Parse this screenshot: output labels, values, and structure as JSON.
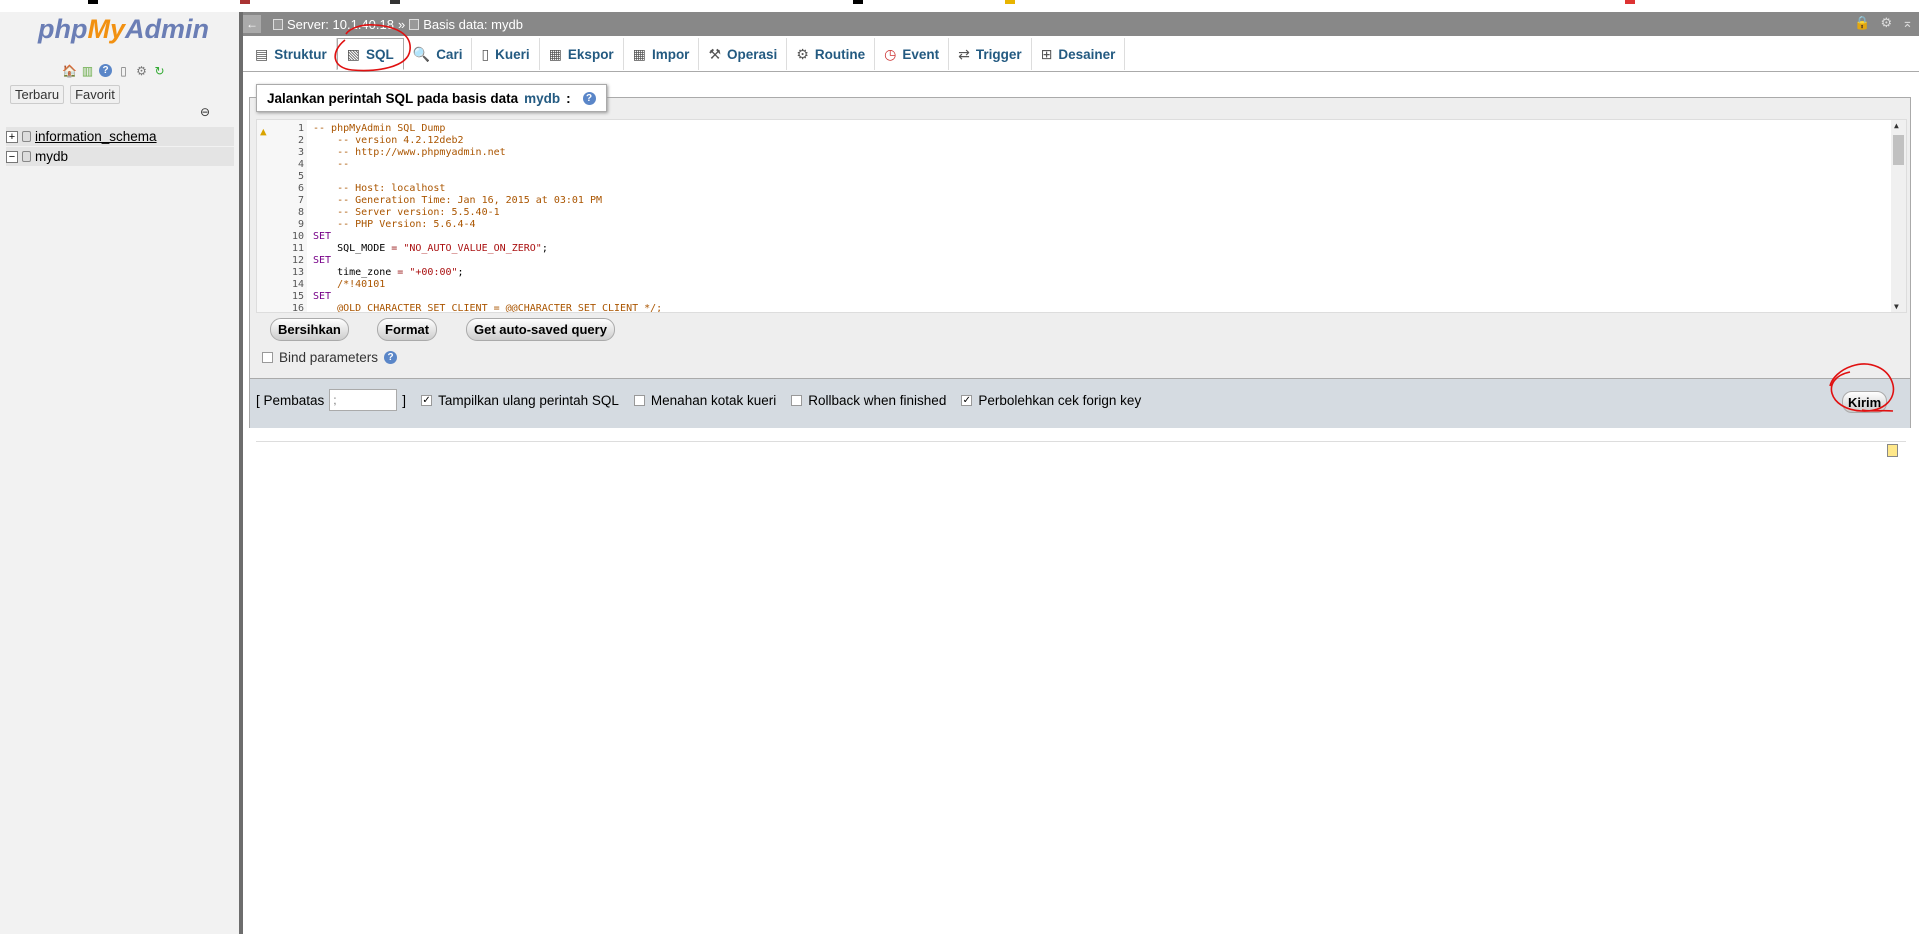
{
  "logo": {
    "php": "php",
    "my": "My",
    "admin": "Admin"
  },
  "sidebar": {
    "quick_icons": [
      "home-icon",
      "exit-icon",
      "help-icon",
      "docs-icon",
      "settings-icon",
      "reload-icon"
    ],
    "recent_label": "Terbaru",
    "favorite_label": "Favorit",
    "databases": [
      {
        "name": "information_schema",
        "toggle": "+"
      },
      {
        "name": "mydb",
        "toggle": "−"
      }
    ]
  },
  "breadcrumb": {
    "back": "←",
    "server": "Server: 10.1.40.18",
    "database": "Basis data: mydb"
  },
  "tabs": [
    {
      "label": "Struktur",
      "icon": "structure-icon"
    },
    {
      "label": "SQL",
      "icon": "sql-icon"
    },
    {
      "label": "Cari",
      "icon": "search-icon"
    },
    {
      "label": "Kueri",
      "icon": "query-icon"
    },
    {
      "label": "Ekspor",
      "icon": "export-icon"
    },
    {
      "label": "Impor",
      "icon": "import-icon"
    },
    {
      "label": "Operasi",
      "icon": "wrench-icon"
    },
    {
      "label": "Routine",
      "icon": "routine-icon"
    },
    {
      "label": "Event",
      "icon": "clock-icon"
    },
    {
      "label": "Trigger",
      "icon": "trigger-icon"
    },
    {
      "label": "Desainer",
      "icon": "designer-icon"
    }
  ],
  "sql": {
    "legend_prefix": "Jalankan perintah SQL pada basis data",
    "legend_db": "mydb",
    "legend_suffix": ":",
    "lines": [
      {
        "n": "1",
        "t": "-- phpMyAdmin SQL Dump"
      },
      {
        "n": "2",
        "t": "    -- version 4.2.12deb2"
      },
      {
        "n": "3",
        "t": "    -- http://www.phpmyadmin.net"
      },
      {
        "n": "4",
        "t": "    --"
      },
      {
        "n": "5",
        "t": ""
      },
      {
        "n": "6",
        "t": "    -- Host: localhost"
      },
      {
        "n": "7",
        "t": "    -- Generation Time: Jan 16, 2015 at 03:01 PM"
      },
      {
        "n": "8",
        "t": "    -- Server version: 5.5.40-1"
      },
      {
        "n": "9",
        "t": "    -- PHP Version: 5.6.4-4"
      },
      {
        "n": "10",
        "t": "SET"
      },
      {
        "n": "11",
        "t": "    SQL_MODE = \"NO_AUTO_VALUE_ON_ZERO\";"
      },
      {
        "n": "12",
        "t": "SET"
      },
      {
        "n": "13",
        "t": "    time_zone = \"+00:00\";"
      },
      {
        "n": "14",
        "t": "    /*!40101"
      },
      {
        "n": "15",
        "t": "SET"
      },
      {
        "n": "16",
        "t": "    @OLD_CHARACTER_SET_CLIENT = @@CHARACTER_SET_CLIENT */;"
      }
    ],
    "btn_clear": "Bersihkan",
    "btn_format": "Format",
    "btn_autosave": "Get auto-saved query",
    "bind_label": "Bind parameters"
  },
  "options": {
    "delimiter_label": "[ Pembatas",
    "delimiter_value": ";",
    "delimiter_close": "]",
    "show_again": "Tampilkan ulang perintah SQL",
    "retain_box": "Menahan kotak kueri",
    "rollback": "Rollback when finished",
    "foreign_key": "Perbolehkan cek forign key",
    "go": "Kirim"
  }
}
